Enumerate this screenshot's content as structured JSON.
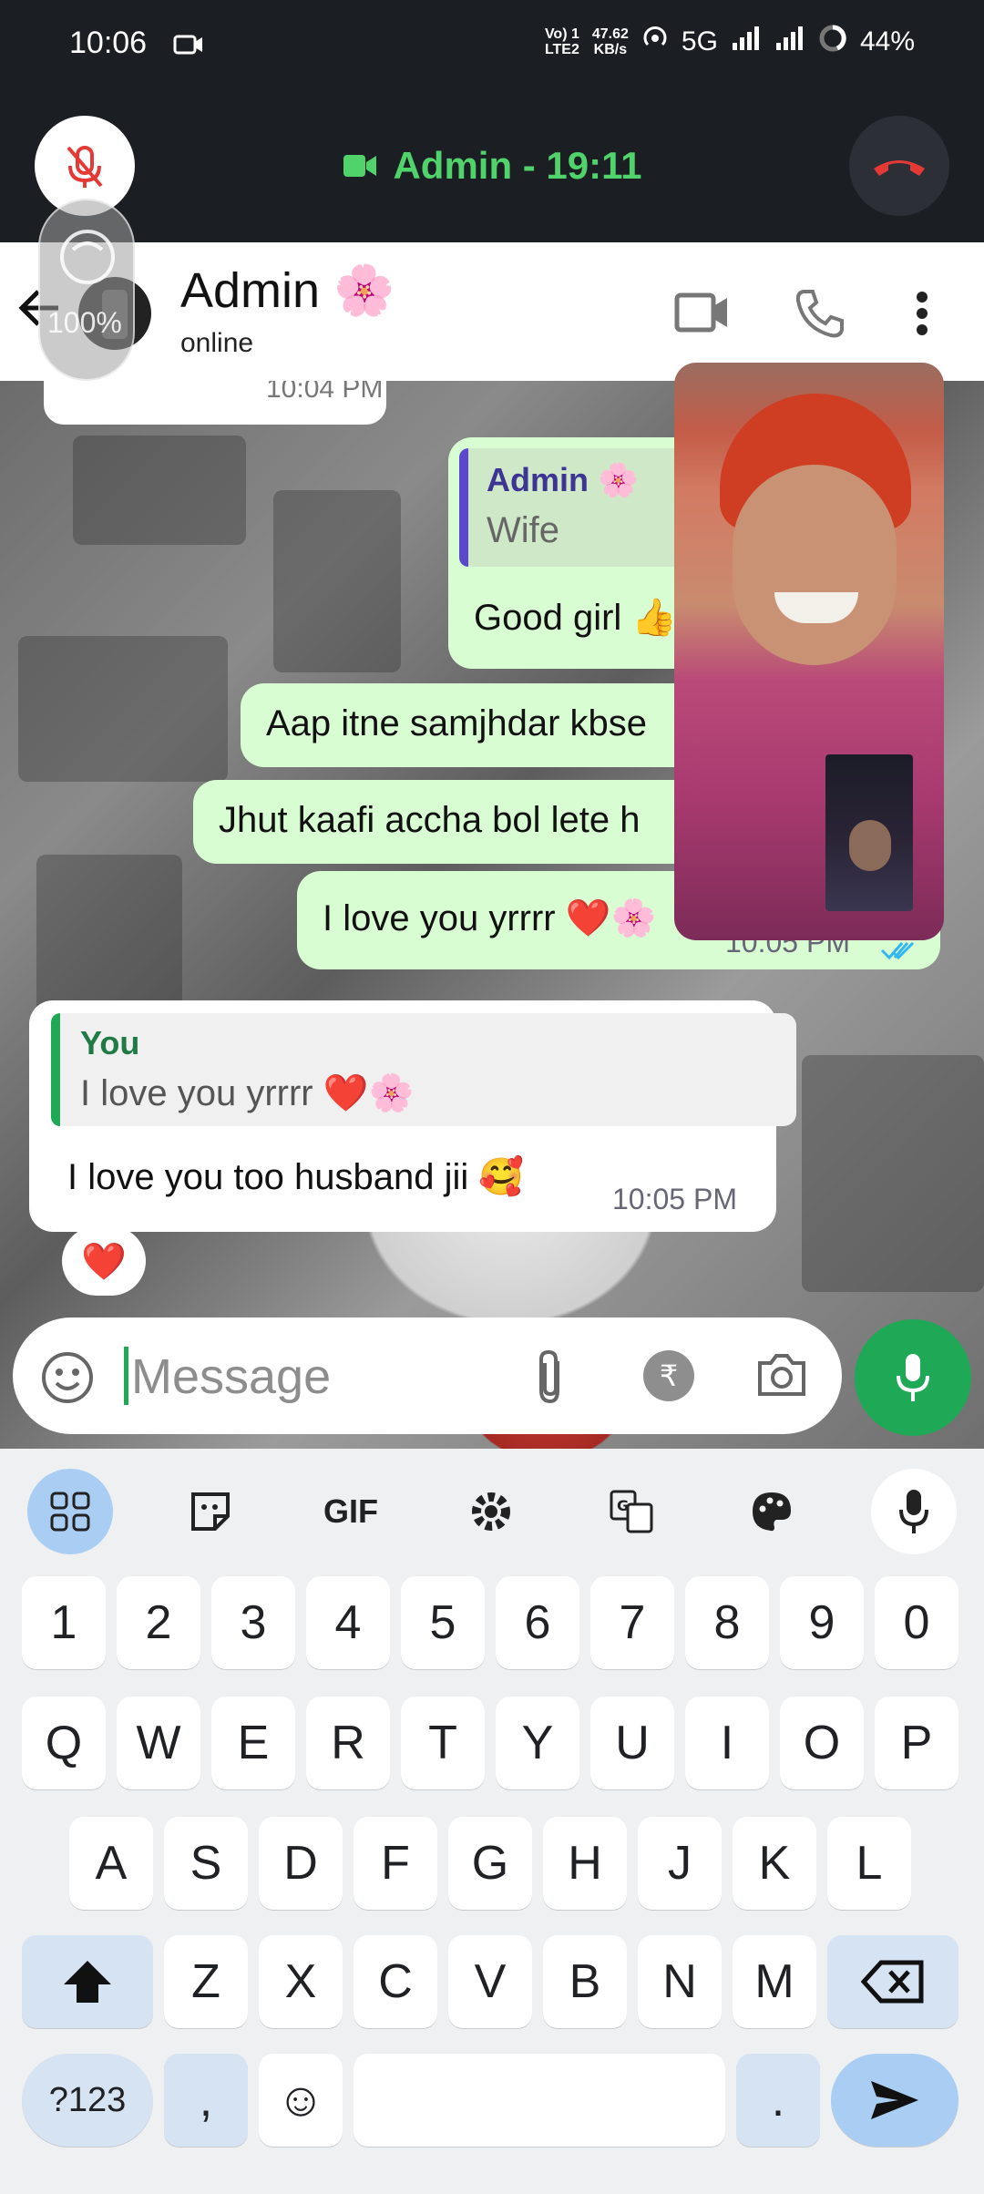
{
  "status_bar": {
    "time": "10:06",
    "net_top": "Vo) 1",
    "net_bottom": "LTE2",
    "speed_top": "47.62",
    "speed_bottom": "KB/s",
    "network": "5G",
    "battery": "44%"
  },
  "call_bar": {
    "title": "Admin - 19:11",
    "accent_color": "#4fd36a",
    "end_color": "#e53935"
  },
  "chat_header": {
    "name": "Admin 🌸",
    "status": "online",
    "beauty_level": "100%"
  },
  "messages": {
    "prev_time": "10:04 PM",
    "quote1_author": "Admin 🌸",
    "quote1_text": "Wife",
    "msg1": "Good girl 👍",
    "msg2": "Aap itne samjhdar kbse",
    "msg3": "Jhut kaafi accha bol lete h",
    "msg4": "I love you yrrrr ❤️🌸",
    "msg4_time": "10:05 PM",
    "quote2_author": "You",
    "quote2_text": "I love you yrrrr ❤️🌸",
    "msg5": "I love you too husband jii 🥰",
    "msg5_time": "10:05 PM",
    "reaction": "❤️"
  },
  "composer": {
    "placeholder": "Message",
    "rupee": "₹"
  },
  "keyboard": {
    "toolbar_gif": "GIF",
    "row_numbers": [
      "1",
      "2",
      "3",
      "4",
      "5",
      "6",
      "7",
      "8",
      "9",
      "0"
    ],
    "row_q": [
      "Q",
      "W",
      "E",
      "R",
      "T",
      "Y",
      "U",
      "I",
      "O",
      "P"
    ],
    "row_a": [
      "A",
      "S",
      "D",
      "F",
      "G",
      "H",
      "J",
      "K",
      "L"
    ],
    "row_z": [
      "Z",
      "X",
      "C",
      "V",
      "B",
      "N",
      "M"
    ],
    "symbols": "?123",
    "comma": ",",
    "emoji": "☺",
    "period": "."
  }
}
